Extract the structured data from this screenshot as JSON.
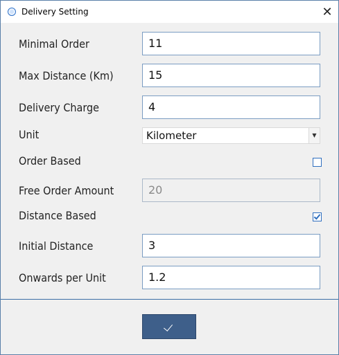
{
  "window": {
    "title": "Delivery Setting",
    "close_symbol": "✕",
    "icon": "app-icon"
  },
  "form": {
    "minimal_order": {
      "label": "Minimal Order",
      "value": "11"
    },
    "max_distance": {
      "label": "Max Distance (Km)",
      "value": "15"
    },
    "delivery_charge": {
      "label": "Delivery Charge",
      "value": "4"
    },
    "unit": {
      "label": "Unit",
      "value": "Kilometer",
      "arrow": "▼"
    },
    "order_based": {
      "label": "Order Based",
      "checked": false
    },
    "free_order_amount": {
      "label": "Free Order Amount",
      "value": "20"
    },
    "distance_based": {
      "label": "Distance Based",
      "checked": true
    },
    "initial_distance": {
      "label": "Initial Distance",
      "value": "3"
    },
    "onwards_per_unit": {
      "label": "Onwards per Unit",
      "value": "1.2"
    }
  },
  "footer": {
    "ok_button_icon": "checkmark-icon",
    "accent_color": "#3e5f8a"
  }
}
